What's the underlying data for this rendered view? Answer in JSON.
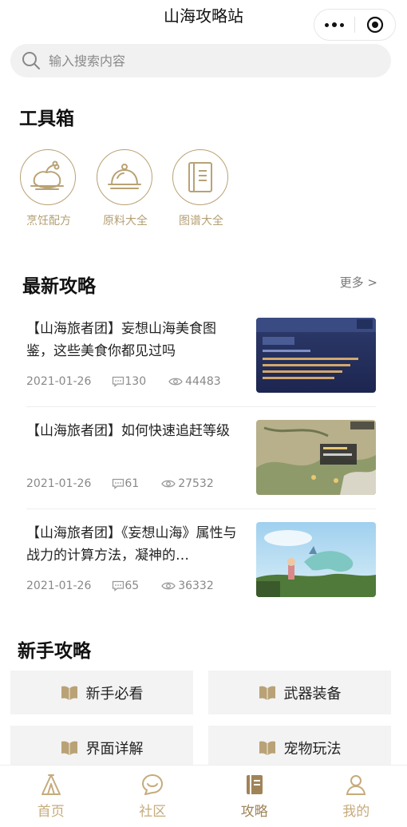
{
  "header": {
    "title": "山海攻略站"
  },
  "search": {
    "placeholder": "输入搜索内容"
  },
  "toolbox": {
    "title": "工具箱",
    "items": [
      {
        "label": "烹饪配方",
        "icon": "chicken-leg-icon"
      },
      {
        "label": "原料大全",
        "icon": "cloche-icon"
      },
      {
        "label": "图谱大全",
        "icon": "book-icon"
      }
    ]
  },
  "latest": {
    "title": "最新攻略",
    "more": "更多 >",
    "articles": [
      {
        "title": "【山海旅者团】妄想山海美食图鉴，这些美食你都见过吗",
        "date": "2021-01-26",
        "comments": "130",
        "views": "44483"
      },
      {
        "title": "【山海旅者团】如何快速追赶等级",
        "date": "2021-01-26",
        "comments": "61",
        "views": "27532"
      },
      {
        "title": "【山海旅者团】《妄想山海》属性与战力的计算方法，凝神的…",
        "date": "2021-01-26",
        "comments": "65",
        "views": "36332"
      }
    ]
  },
  "newbie": {
    "title": "新手攻略",
    "items": [
      {
        "label": "新手必看"
      },
      {
        "label": "武器装备"
      },
      {
        "label": "界面详解"
      },
      {
        "label": "宠物玩法"
      }
    ]
  },
  "nav": {
    "items": [
      {
        "label": "首页",
        "icon": "tent-icon"
      },
      {
        "label": "社区",
        "icon": "chat-face-icon"
      },
      {
        "label": "攻略",
        "icon": "guide-book-icon"
      },
      {
        "label": "我的",
        "icon": "user-icon"
      }
    ]
  },
  "colors": {
    "accent": "#b9a275",
    "accent_text": "#b49f73"
  }
}
